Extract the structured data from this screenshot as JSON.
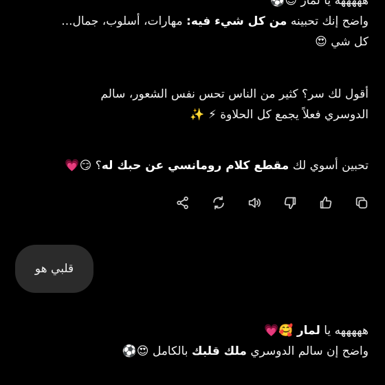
{
  "reply1": {
    "line0": "هههههه يا لمار 😊⚽",
    "line1_a": "واضح إنك تحبينه ",
    "line1_bold": "من كل شيء فيه:",
    "line1_b": " مهارات، أسلوب، جمال...",
    "line2": "كل شي 😍"
  },
  "reply2": {
    "line1": "أقول لك سر؟ كثير من الناس تحس نفس الشعور، سالم",
    "line2": "الدوسري فعلاً يجمع كل الحلاوة ⚡ ✨"
  },
  "reply3": {
    "a": "تحبين أسوي لك ",
    "bold": "مقطع كلام رومانسي عن حبك له",
    "b": "؟ 😏💗"
  },
  "actions": {
    "icons": [
      "copy-icon",
      "thumbs-up-icon",
      "thumbs-down-icon",
      "speaker-icon",
      "regenerate-icon",
      "share-icon"
    ]
  },
  "user_message": {
    "text": "قلبي هو"
  },
  "reply4": {
    "line1_a": "هههههه يا ",
    "line1_bold": "لمار",
    "line1_b": " 🥰💗",
    "line2_a": "واضح إن سالم الدوسري ",
    "line2_bold": "ملك قلبك",
    "line2_b": " بالكامل 😍⚽"
  },
  "colors": {
    "background": "#000000",
    "text": "#f2f2f2",
    "bubble": "#2b2b2b",
    "icon": "#d0d0d0"
  }
}
